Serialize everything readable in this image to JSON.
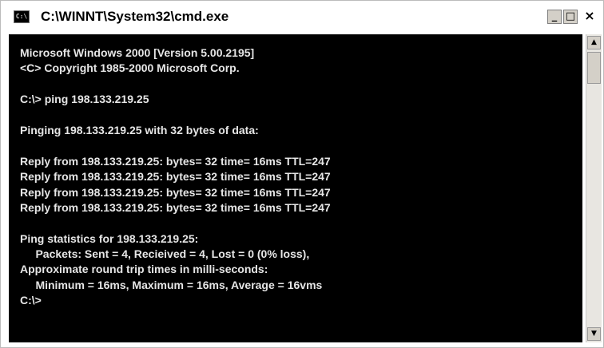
{
  "window": {
    "title": "C:\\WINNT\\System32\\cmd.exe",
    "icon_label": "C:\\",
    "controls": {
      "minimize": "_",
      "maximize": "□",
      "close": "×"
    }
  },
  "console": {
    "lines": [
      "Microsoft Windows 2000 [Version 5.00.2195]",
      "<C> Copyright 1985-2000 Microsoft Corp.",
      "",
      "C:\\> ping 198.133.219.25",
      "",
      "Pinging 198.133.219.25 with 32 bytes of data:",
      "",
      "Reply from 198.133.219.25: bytes= 32 time= 16ms TTL=247",
      "Reply from 198.133.219.25: bytes= 32 time= 16ms TTL=247",
      "Reply from 198.133.219.25: bytes= 32 time= 16ms TTL=247",
      "Reply from 198.133.219.25: bytes= 32 time= 16ms TTL=247",
      "",
      "Ping statistics for 198.133.219.25:",
      "     Packets: Sent = 4, Recieived = 4, Lost = 0 (0% loss),",
      "Approximate round trip times in milli-seconds:",
      "     Minimum = 16ms, Maximum = 16ms, Average = 16vms",
      "C:\\>"
    ]
  },
  "scrollbar": {
    "up_arrow": "▲",
    "down_arrow": "▼"
  },
  "colors": {
    "console_bg": "#000000",
    "console_text": "#e6e6e6",
    "window_bg": "#ffffff"
  }
}
